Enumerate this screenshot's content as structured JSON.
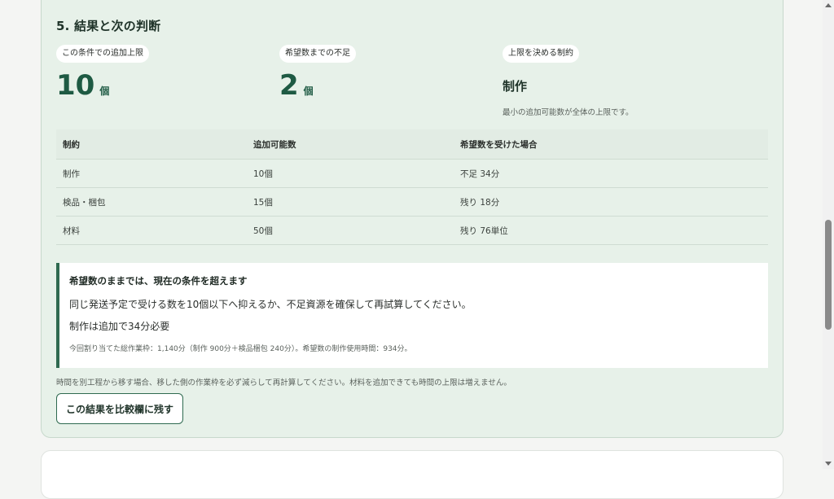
{
  "section": {
    "title": "5. 結果と次の判断"
  },
  "metrics": [
    {
      "label": "この条件での追加上限",
      "value": "10",
      "unit": "個"
    },
    {
      "label": "希望数までの不足",
      "value": "2",
      "unit": "個"
    },
    {
      "label": "上限を決める制約",
      "value": "制作",
      "note": "最小の追加可能数が全体の上限です。"
    }
  ],
  "table": {
    "headers": [
      "制約",
      "追加可能数",
      "希望数を受けた場合"
    ],
    "rows": [
      [
        "制作",
        "10個",
        "不足 34分"
      ],
      [
        "検品・梱包",
        "15個",
        "残り 18分"
      ],
      [
        "材料",
        "50個",
        "残り 76単位"
      ]
    ]
  },
  "alert": {
    "title": "希望数のままでは、現在の条件を超えます",
    "body": "同じ発送予定で受ける数を10個以下へ抑えるか、不足資源を確保して再試算してください。",
    "sub": "制作は追加で34分必要",
    "detail": "今回割り当てた総作業枠：1,140分（制作 900分＋検品梱包 240分）。希望数の制作使用時間：934分。"
  },
  "footnote": "時間を別工程から移す場合、移した側の作業枠を必ず減らして再計算してください。材料を追加できても時間の上限は増えません。",
  "buttons": {
    "keep_result": "この結果を比較欄に残す"
  },
  "colors": {
    "card_bg": "#e7f1e9",
    "accent": "#1e5a43",
    "alert_border": "#2f6a50"
  }
}
